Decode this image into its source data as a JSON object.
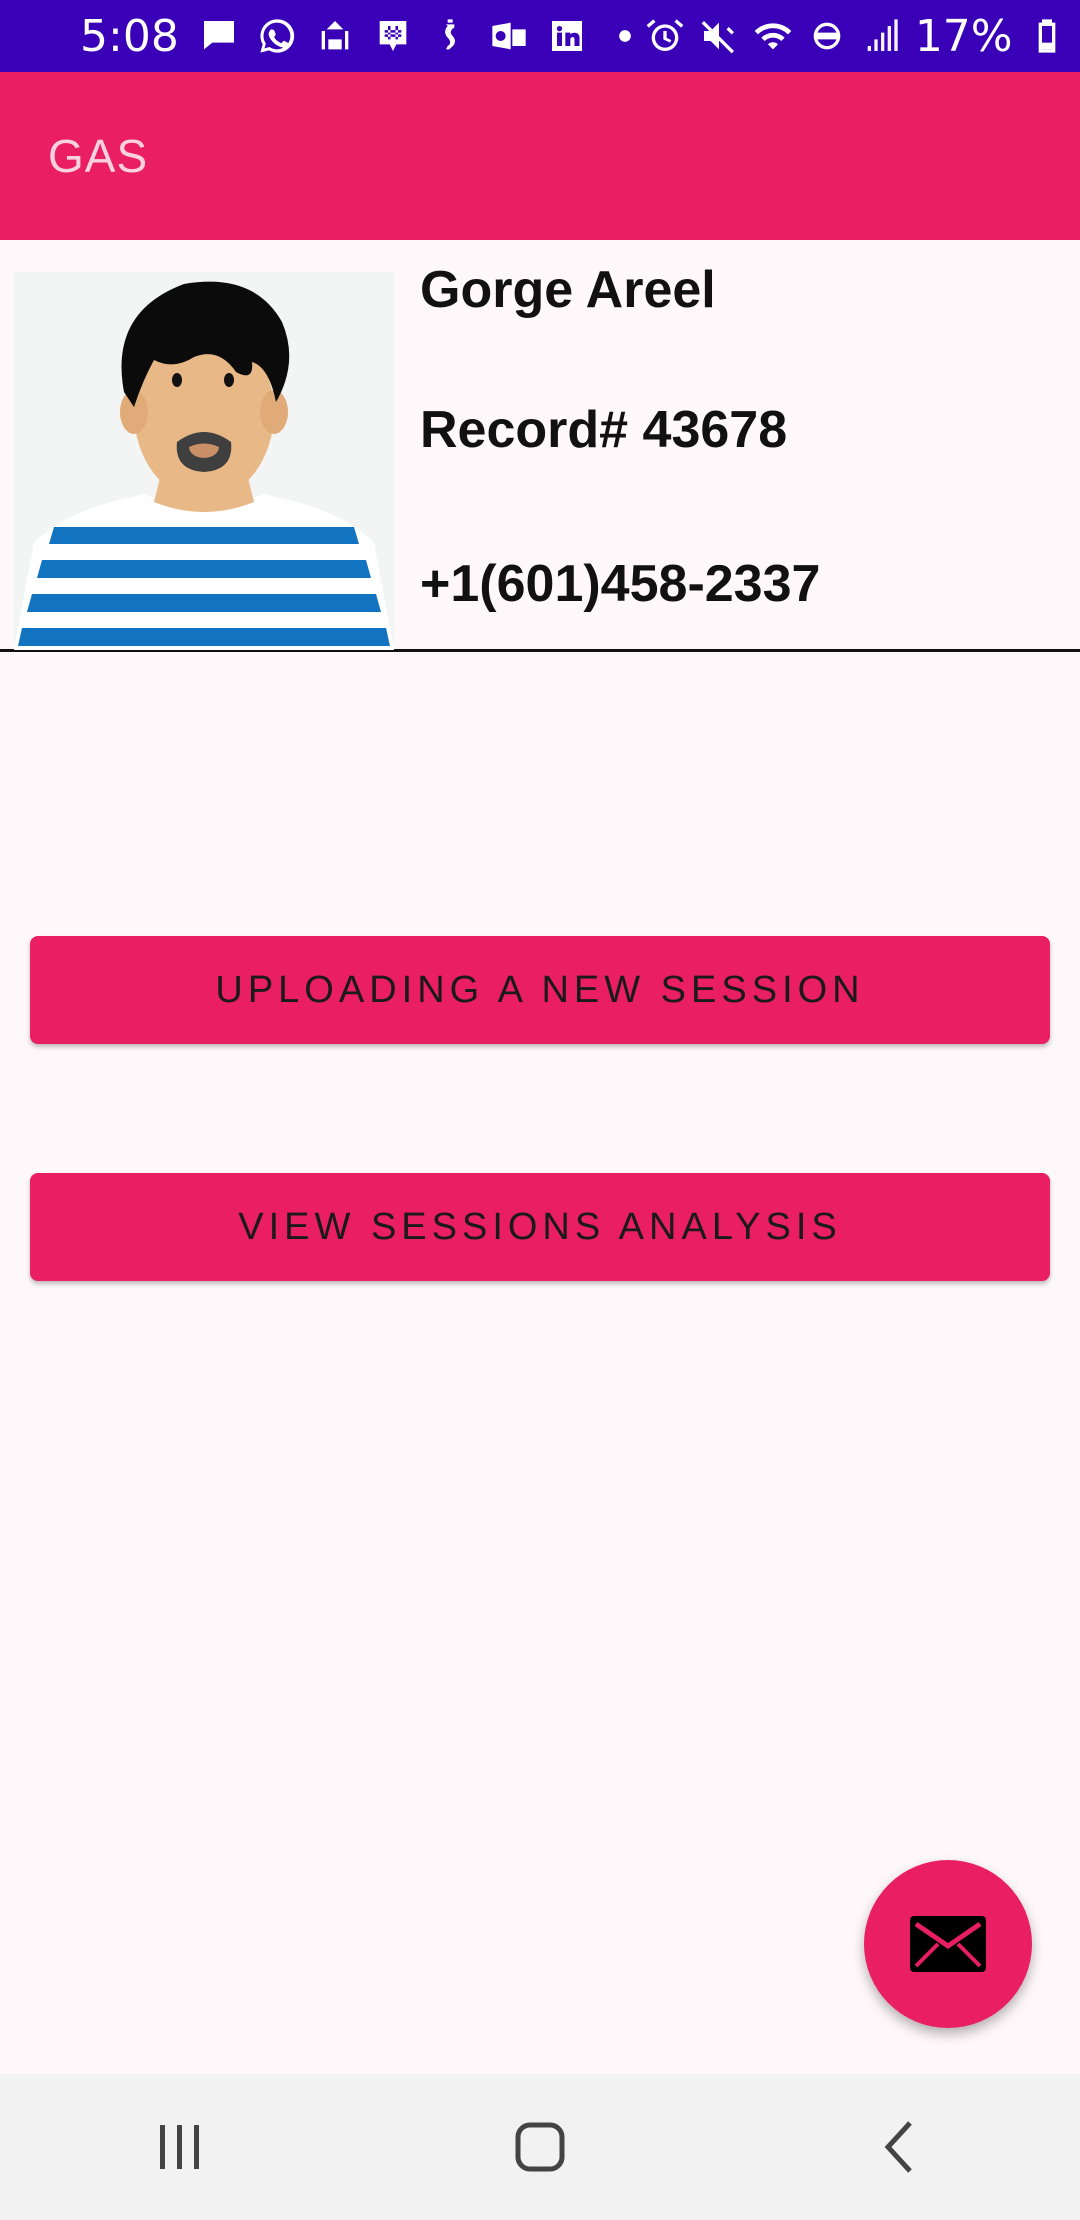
{
  "status_bar": {
    "time": "5:08",
    "battery": "17%",
    "icons_left": [
      "message-icon",
      "whatsapp-icon",
      "app-icon",
      "slack-icon",
      "sound-icon",
      "outlook-icon",
      "linkedin-icon",
      "dot-icon"
    ],
    "icons_right": [
      "alarm-icon",
      "mute-icon",
      "wifi-icon",
      "volte-icon",
      "signal-icon",
      "battery-icon"
    ]
  },
  "app_bar": {
    "title": "GAS"
  },
  "profile": {
    "name": "Gorge Areel",
    "record": "Record# 43678",
    "phone": "+1(601)458-2337"
  },
  "actions": {
    "upload_label": "UPLOADING A NEW SESSION",
    "view_label": "VIEW SESSIONS ANALYSIS"
  },
  "fab": {
    "icon": "mail-icon"
  },
  "nav_bar": {
    "icons": [
      "recent-apps-icon",
      "home-icon",
      "back-icon"
    ]
  },
  "colors": {
    "status_bar": "#3a00b7",
    "accent": "#e91e63",
    "background": "#fff8fa"
  }
}
